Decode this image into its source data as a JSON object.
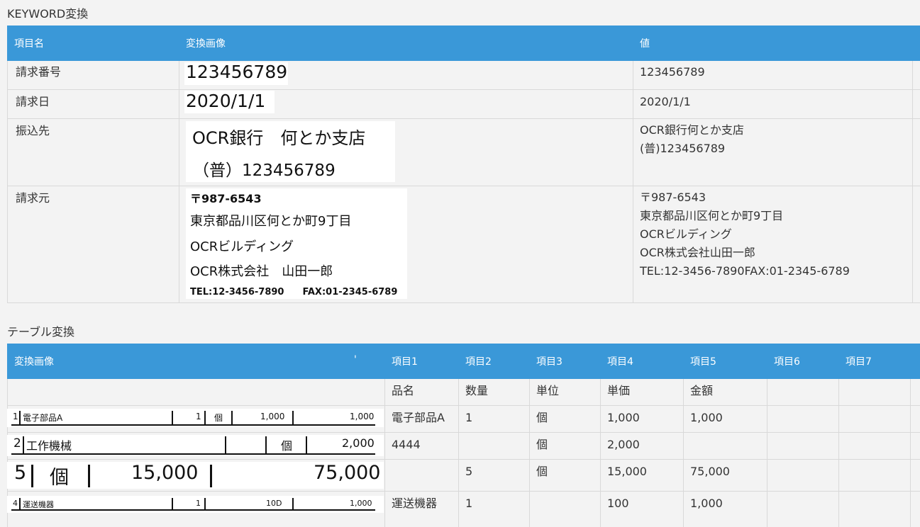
{
  "keyword_section": {
    "title": "KEYWORD変換",
    "headers": [
      "項目名",
      "変換画像",
      "値"
    ],
    "rows": [
      {
        "name": "請求番号",
        "image_lines": [
          "123456789"
        ],
        "value_lines": [
          "123456789"
        ]
      },
      {
        "name": "請求日",
        "image_lines": [
          "2020/1/1"
        ],
        "value_lines": [
          "2020/1/1"
        ]
      },
      {
        "name": "振込先",
        "image_lines": [
          "OCR銀行　何とか支店",
          "（普）123456789"
        ],
        "value_lines": [
          "OCR銀行何とか支店",
          "(普)123456789"
        ]
      },
      {
        "name": "請求元",
        "image_lines": [
          "〒987-6543",
          "東京都品川区何とか町9丁目",
          "OCRビルディング",
          "OCR株式会社　山田一郎",
          "TEL:12-3456-7890　　FAX:01-2345-6789"
        ],
        "value_lines": [
          "〒987-6543",
          "東京都品川区何とか町9丁目",
          "OCRビルディング",
          "OCR株式会社山田一郎",
          "TEL:12-3456-7890FAX:01-2345-6789"
        ]
      }
    ]
  },
  "table_section": {
    "title": "テーブル変換",
    "headers": [
      "変換画像",
      "'",
      "項目1",
      "項目2",
      "項目3",
      "項目4",
      "項目5",
      "項目6",
      "項目7"
    ],
    "label_row": [
      "品名",
      "数量",
      "単位",
      "単価",
      "金額"
    ],
    "image_rows": [
      {
        "cells": [
          "1",
          "電子部品A",
          "1",
          "個",
          "1,000",
          "1,000"
        ]
      },
      {
        "cells": [
          "2",
          "工作機械",
          "個",
          "2,000"
        ]
      },
      {
        "cells": [
          "5",
          "個",
          "15,000",
          "75,000"
        ]
      },
      {
        "cells": [
          "4",
          "運送機器",
          "1",
          "10D",
          "1,000"
        ]
      }
    ],
    "rows": [
      {
        "item1": "電子部品A",
        "item2": "1",
        "item3": "個",
        "item4": "1,000",
        "item5": "1,000"
      },
      {
        "item1": "4444",
        "item2": "",
        "item3": "個",
        "item4": "2,000",
        "item5": ""
      },
      {
        "item1": "",
        "item2": "5",
        "item3": "個",
        "item4": "15,000",
        "item5": "75,000"
      },
      {
        "item1": "運送機器",
        "item2": "1",
        "item3": "",
        "item4": "100",
        "item5": "1,000"
      }
    ]
  },
  "colors": {
    "header_bg": "#3a98d8",
    "header_text": "#ffffff",
    "page_bg": "#f3f3f3",
    "grid": "#d9d9d9"
  }
}
